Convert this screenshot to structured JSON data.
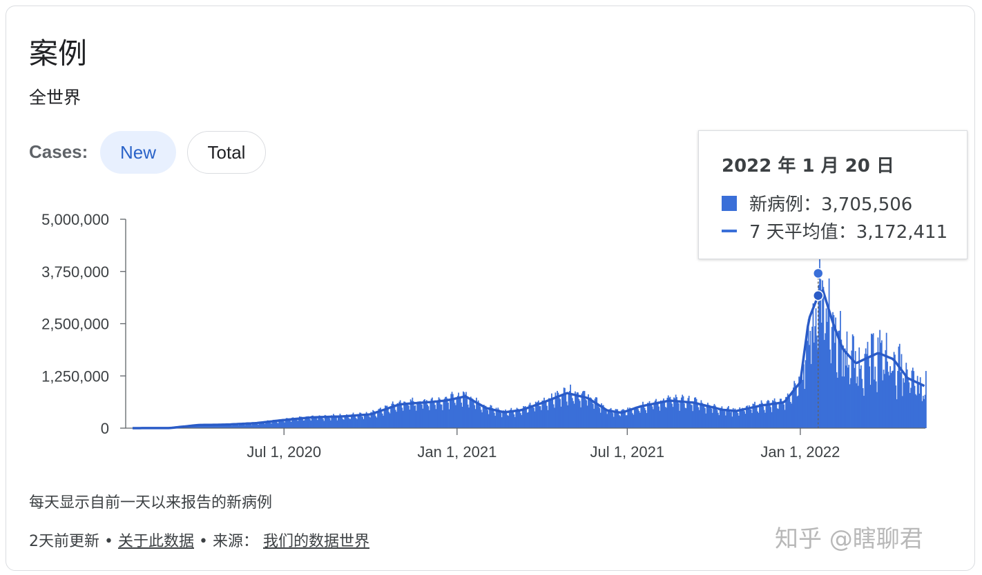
{
  "header": {
    "title": "案例",
    "subtitle": "全世界"
  },
  "filters": {
    "label": "Cases:",
    "options": [
      "New",
      "Total"
    ],
    "selected": "New"
  },
  "tooltip": {
    "date": "2022 年 1 月 20 日",
    "new_cases_label": "新病例：3,705,506",
    "avg_label": "7 天平均值：3,172,411"
  },
  "footnote": "每天显示自前一天以来报告的新病例",
  "footer": {
    "updated": "2天前更新",
    "sep": "•",
    "about_link": "关于此数据",
    "source_prefix": "来源：",
    "source_link": "我们的数据世界"
  },
  "watermark": "知乎 @瞎聊君",
  "colors": {
    "bar": "#3a6fd8",
    "line": "#2a5bc7",
    "axis": "#5f6368"
  },
  "chart_data": {
    "type": "bar",
    "title": "",
    "xlabel": "",
    "ylabel": "",
    "ylim": [
      0,
      5000000
    ],
    "yticks": [
      0,
      1250000,
      2500000,
      3750000,
      5000000
    ],
    "ytick_labels": [
      "0",
      "1,250,000",
      "2,500,000",
      "3,750,000",
      "5,000,000"
    ],
    "x_range": [
      "2020-01-22",
      "2022-05-14"
    ],
    "xticks": [
      "2020-07-01",
      "2021-01-01",
      "2021-07-01",
      "2022-01-01"
    ],
    "xtick_labels": [
      "Jul 1, 2020",
      "Jan 1, 2021",
      "Jul 1, 2021",
      "Jan 1, 2022"
    ],
    "highlight": {
      "date": "2022-01-20",
      "new_cases": 3705506,
      "avg_7day": 3172411
    },
    "series": [
      {
        "name": "新病例",
        "kind": "bar"
      },
      {
        "name": "7 天平均值",
        "kind": "line",
        "points": [
          [
            "2020-01-22",
            500
          ],
          [
            "2020-03-01",
            2000
          ],
          [
            "2020-04-01",
            75000
          ],
          [
            "2020-05-01",
            85000
          ],
          [
            "2020-06-01",
            120000
          ],
          [
            "2020-07-01",
            195000
          ],
          [
            "2020-08-01",
            260000
          ],
          [
            "2020-09-01",
            280000
          ],
          [
            "2020-10-01",
            330000
          ],
          [
            "2020-11-01",
            570000
          ],
          [
            "2020-12-01",
            620000
          ],
          [
            "2020-12-20",
            660000
          ],
          [
            "2021-01-10",
            760000
          ],
          [
            "2021-02-01",
            480000
          ],
          [
            "2021-02-20",
            380000
          ],
          [
            "2021-03-10",
            430000
          ],
          [
            "2021-04-01",
            600000
          ],
          [
            "2021-04-28",
            840000
          ],
          [
            "2021-05-20",
            720000
          ],
          [
            "2021-06-10",
            420000
          ],
          [
            "2021-06-25",
            370000
          ],
          [
            "2021-07-15",
            520000
          ],
          [
            "2021-08-15",
            660000
          ],
          [
            "2021-09-10",
            610000
          ],
          [
            "2021-10-10",
            440000
          ],
          [
            "2021-10-25",
            410000
          ],
          [
            "2021-11-20",
            540000
          ],
          [
            "2021-12-15",
            620000
          ],
          [
            "2022-01-01",
            1100000
          ],
          [
            "2022-01-10",
            2600000
          ],
          [
            "2022-01-20",
            3172411
          ],
          [
            "2022-01-25",
            3300000
          ],
          [
            "2022-02-05",
            2500000
          ],
          [
            "2022-02-15",
            1900000
          ],
          [
            "2022-03-01",
            1550000
          ],
          [
            "2022-03-15",
            1700000
          ],
          [
            "2022-03-25",
            1800000
          ],
          [
            "2022-04-10",
            1650000
          ],
          [
            "2022-04-25",
            1200000
          ],
          [
            "2022-05-14",
            1000000
          ]
        ]
      }
    ]
  }
}
